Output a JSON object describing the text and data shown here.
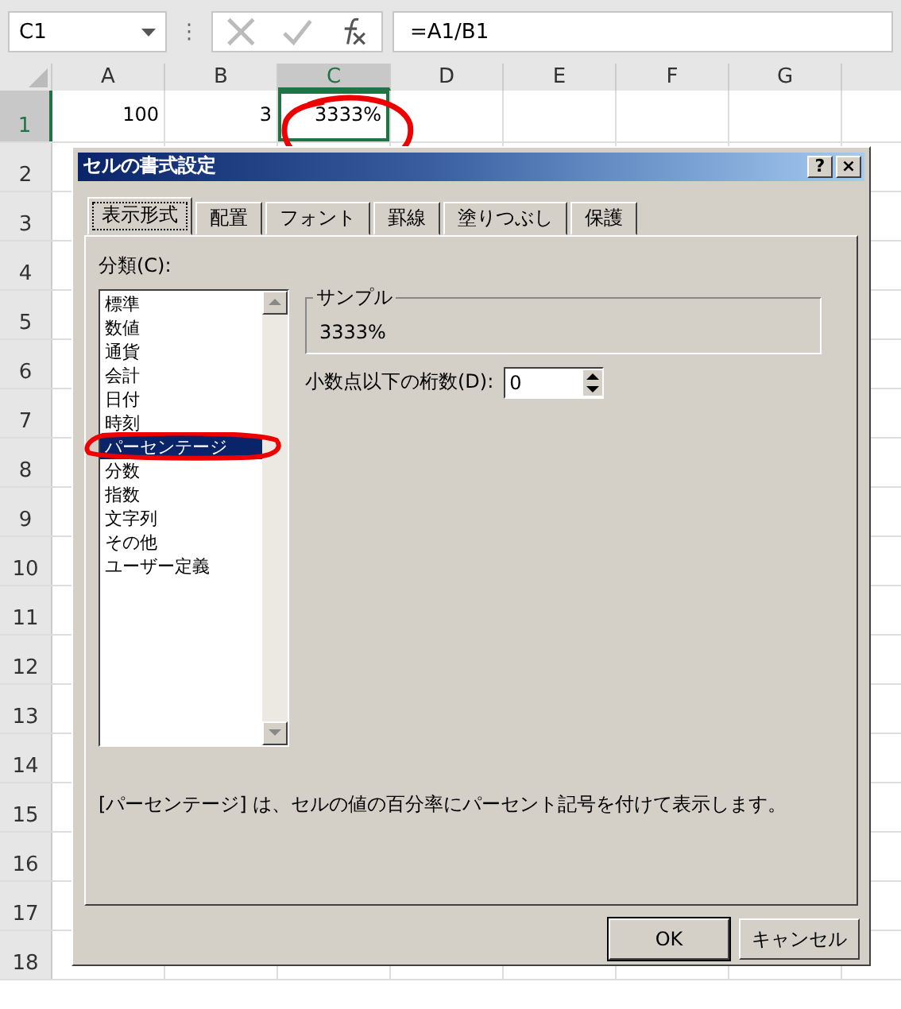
{
  "name_box": {
    "value": "C1"
  },
  "formula_bar": {
    "more": "⋮",
    "value": "=A1/B1"
  },
  "columns": [
    {
      "label": "A",
      "selected": false
    },
    {
      "label": "B",
      "selected": false
    },
    {
      "label": "C",
      "selected": true
    },
    {
      "label": "D",
      "selected": false
    },
    {
      "label": "E",
      "selected": false
    },
    {
      "label": "F",
      "selected": false
    },
    {
      "label": "G",
      "selected": false
    }
  ],
  "rows": [
    {
      "label": "1",
      "selected": true,
      "cells": [
        "100",
        "3",
        "3333%"
      ]
    },
    {
      "label": "2",
      "selected": false,
      "cells": []
    },
    {
      "label": "3",
      "selected": false,
      "cells": []
    },
    {
      "label": "4",
      "selected": false,
      "cells": []
    },
    {
      "label": "5",
      "selected": false,
      "cells": []
    },
    {
      "label": "6",
      "selected": false,
      "cells": []
    },
    {
      "label": "7",
      "selected": false,
      "cells": []
    },
    {
      "label": "8",
      "selected": false,
      "cells": []
    },
    {
      "label": "9",
      "selected": false,
      "cells": []
    },
    {
      "label": "10",
      "selected": false,
      "cells": []
    },
    {
      "label": "11",
      "selected": false,
      "cells": []
    },
    {
      "label": "12",
      "selected": false,
      "cells": []
    },
    {
      "label": "13",
      "selected": false,
      "cells": []
    },
    {
      "label": "14",
      "selected": false,
      "cells": []
    },
    {
      "label": "15",
      "selected": false,
      "cells": []
    },
    {
      "label": "16",
      "selected": false,
      "cells": []
    },
    {
      "label": "17",
      "selected": false,
      "cells": []
    },
    {
      "label": "18",
      "selected": false,
      "cells": []
    }
  ],
  "dialog": {
    "title": "セルの書式設定",
    "help": "?",
    "close": "×",
    "tabs": [
      {
        "label": "表示形式",
        "selected": true
      },
      {
        "label": "配置",
        "selected": false
      },
      {
        "label": "フォント",
        "selected": false
      },
      {
        "label": "罫線",
        "selected": false
      },
      {
        "label": "塗りつぶし",
        "selected": false
      },
      {
        "label": "保護",
        "selected": false
      }
    ],
    "category_label": "分類(C):",
    "categories": [
      {
        "label": "標準",
        "selected": false
      },
      {
        "label": "数値",
        "selected": false
      },
      {
        "label": "通貨",
        "selected": false
      },
      {
        "label": "会計",
        "selected": false
      },
      {
        "label": "日付",
        "selected": false
      },
      {
        "label": "時刻",
        "selected": false
      },
      {
        "label": "パーセンテージ",
        "selected": true
      },
      {
        "label": "分数",
        "selected": false
      },
      {
        "label": "指数",
        "selected": false
      },
      {
        "label": "文字列",
        "selected": false
      },
      {
        "label": "その他",
        "selected": false
      },
      {
        "label": "ユーザー定義",
        "selected": false
      }
    ],
    "sample": {
      "label": "サンプル",
      "value": "3333%"
    },
    "decimals": {
      "label": "小数点以下の桁数(D):",
      "value": "0"
    },
    "description": "[パーセンテージ] は、セルの値の百分率にパーセント記号を付けて表示します。",
    "buttons": [
      {
        "label": "OK",
        "default": true
      },
      {
        "label": "キャンセル",
        "default": false
      }
    ]
  }
}
